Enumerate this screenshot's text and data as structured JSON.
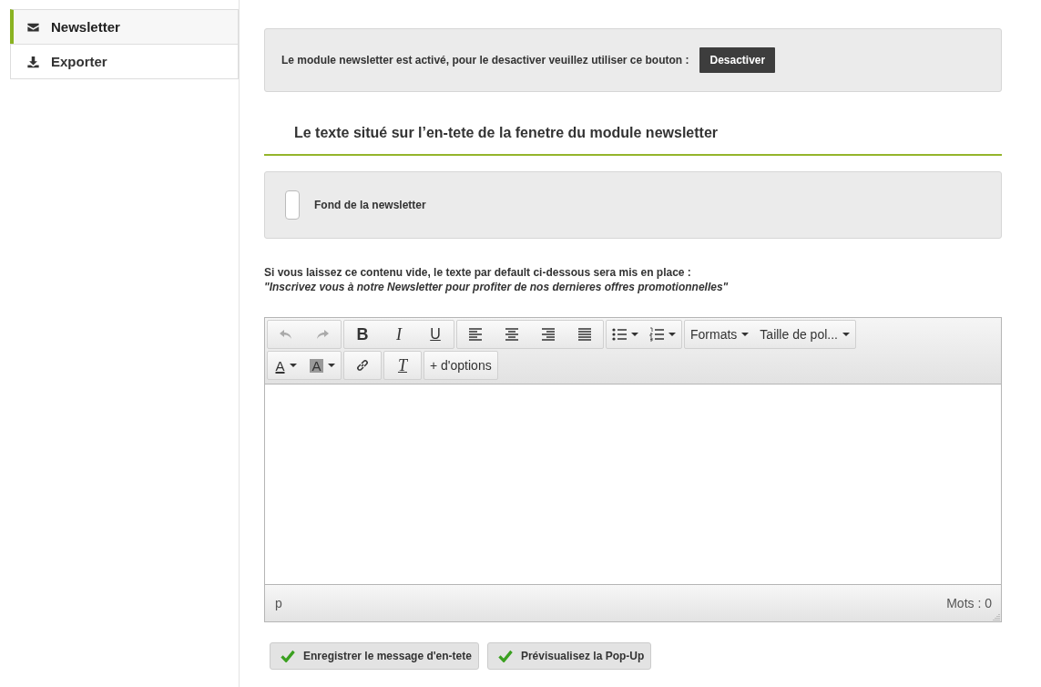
{
  "sidebar": {
    "items": [
      {
        "label": "Newsletter",
        "selected": true
      },
      {
        "label": "Exporter",
        "selected": false
      }
    ]
  },
  "status_panel": {
    "text": "Le module newsletter est activé, pour le desactiver veuillez utiliser ce bouton :",
    "button": "Desactiver"
  },
  "section_title": "Le texte situé sur l’en-tete de la fenetre du module newsletter",
  "background_panel": {
    "label": "Fond de la newsletter",
    "color": "#ffffff"
  },
  "hint": {
    "text": "Si vous laissez ce contenu vide, le texte par default ci-dessous sera mis en place :",
    "default_text": "\"Inscrivez vous à notre Newsletter pour profiter de nos dernieres offres promotionnelles\""
  },
  "editor": {
    "toolbar": [
      [
        [
          {
            "kind": "undo",
            "disabled": true
          },
          {
            "kind": "redo",
            "disabled": true
          }
        ],
        [
          {
            "kind": "bold",
            "label": "B",
            "disabled": false
          },
          {
            "kind": "italic",
            "label": "I",
            "disabled": false
          },
          {
            "kind": "underline",
            "label": "U",
            "disabled": false
          }
        ],
        [
          {
            "kind": "align-left",
            "disabled": false
          },
          {
            "kind": "align-center",
            "disabled": false
          },
          {
            "kind": "align-right",
            "disabled": false
          },
          {
            "kind": "justify",
            "disabled": false
          }
        ],
        [
          {
            "kind": "bullet-list",
            "disabled": false
          },
          {
            "kind": "numbered-list",
            "disabled": false
          }
        ],
        [
          {
            "kind": "menu",
            "label": "Formats",
            "disabled": false
          },
          {
            "kind": "menu",
            "label": "Taille de pol...",
            "disabled": false
          }
        ]
      ],
      [
        [
          {
            "kind": "text-color",
            "label": "A",
            "disabled": false
          },
          {
            "kind": "background-color",
            "label": "A",
            "disabled": false
          }
        ],
        [
          {
            "kind": "link",
            "disabled": false
          }
        ],
        [
          {
            "kind": "clear-format",
            "label": "T",
            "disabled": false
          }
        ],
        [
          {
            "kind": "text",
            "label": "+ d'options",
            "disabled": false
          }
        ]
      ]
    ],
    "path": "p",
    "word_count": "Mots : 0"
  },
  "buttons": [
    "Enregistrer le message d'en-tete",
    "Prévisualisez la Pop-Up"
  ]
}
